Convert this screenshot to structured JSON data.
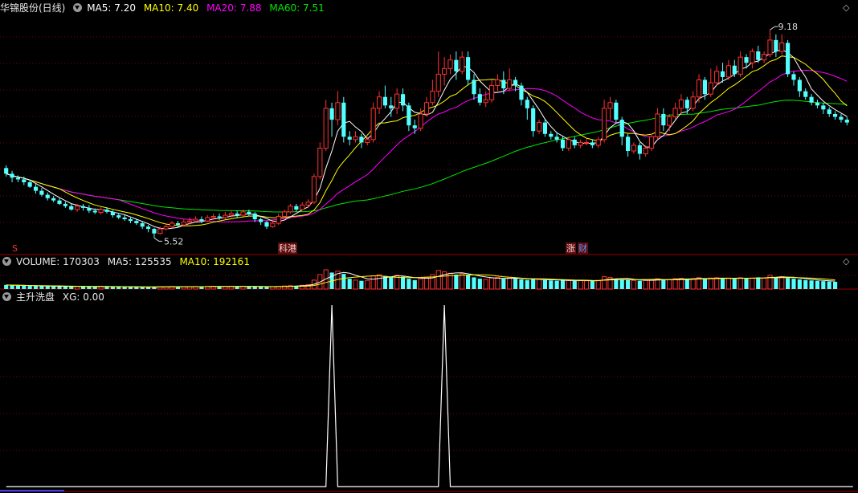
{
  "main_header": {
    "stock_name": "华锦股份(日线)",
    "ma5_label": "MA5: 7.20",
    "ma10_label": "MA10: 7.40",
    "ma20_label": "MA20: 7.88",
    "ma60_label": "MA60: 7.51"
  },
  "volume_header": {
    "volume_label": "VOLUME: 170303",
    "ma5_label": "MA5: 125535",
    "ma10_label": "MA10: 192161"
  },
  "indicator_header": {
    "name": "主升洗盘",
    "xg_label": "XG: 0.00"
  },
  "colors": {
    "up": "#ff3232",
    "down": "#54ffff",
    "ma5": "#ffffff",
    "ma10": "#ffff00",
    "ma20": "#ff00ff",
    "ma60": "#00e600",
    "grid": "#7a0000"
  },
  "chart_data": [
    {
      "type": "candlestick",
      "ylim": [
        5.3,
        9.45
      ],
      "high_marker": "9.18",
      "low_marker": "5.52",
      "event_badges": [
        "S",
        "科港",
        "涨",
        "财"
      ],
      "candles": [
        [
          6.75,
          6.65,
          6.8,
          6.6
        ],
        [
          6.65,
          6.58,
          6.7,
          6.5
        ],
        [
          6.58,
          6.55,
          6.62,
          6.5
        ],
        [
          6.55,
          6.5,
          6.6,
          6.45
        ],
        [
          6.5,
          6.42,
          6.55,
          6.4
        ],
        [
          6.42,
          6.35,
          6.47,
          6.3
        ],
        [
          6.35,
          6.28,
          6.4,
          6.25
        ],
        [
          6.28,
          6.22,
          6.32,
          6.18
        ],
        [
          6.22,
          6.18,
          6.26,
          6.15
        ],
        [
          6.18,
          6.12,
          6.22,
          6.1
        ],
        [
          6.12,
          6.08,
          6.16,
          6.05
        ],
        [
          6.08,
          6.02,
          6.12,
          6.0
        ],
        [
          6.02,
          6.08,
          6.12,
          5.98
        ],
        [
          6.08,
          6.05,
          6.12,
          6.0
        ],
        [
          6.05,
          6.0,
          6.1,
          5.96
        ],
        [
          6.0,
          5.97,
          6.04,
          5.94
        ],
        [
          5.97,
          6.02,
          6.06,
          5.93
        ],
        [
          6.02,
          5.98,
          6.06,
          5.95
        ],
        [
          5.98,
          5.92,
          6.01,
          5.88
        ],
        [
          5.92,
          5.88,
          5.96,
          5.85
        ],
        [
          5.88,
          5.85,
          5.92,
          5.82
        ],
        [
          5.85,
          5.82,
          5.88,
          5.78
        ],
        [
          5.82,
          5.78,
          5.85,
          5.75
        ],
        [
          5.78,
          5.72,
          5.82,
          5.68
        ],
        [
          5.72,
          5.68,
          5.75,
          5.62
        ],
        [
          5.68,
          5.6,
          5.7,
          5.52
        ],
        [
          5.6,
          5.68,
          5.72,
          5.58
        ],
        [
          5.68,
          5.72,
          5.78,
          5.65
        ],
        [
          5.72,
          5.78,
          5.82,
          5.7
        ],
        [
          5.78,
          5.75,
          5.82,
          5.7
        ],
        [
          5.75,
          5.8,
          5.85,
          5.72
        ],
        [
          5.8,
          5.82,
          5.88,
          5.76
        ],
        [
          5.82,
          5.85,
          5.9,
          5.8
        ],
        [
          5.85,
          5.82,
          5.9,
          5.78
        ],
        [
          5.82,
          5.88,
          5.92,
          5.8
        ],
        [
          5.88,
          5.9,
          5.95,
          5.84
        ],
        [
          5.9,
          5.88,
          5.95,
          5.84
        ],
        [
          5.88,
          5.92,
          5.98,
          5.85
        ],
        [
          5.92,
          5.95,
          6.0,
          5.88
        ],
        [
          5.95,
          5.92,
          6.0,
          5.88
        ],
        [
          5.92,
          5.98,
          6.02,
          5.9
        ],
        [
          5.98,
          5.95,
          6.02,
          5.9
        ],
        [
          5.95,
          5.85,
          5.98,
          5.8
        ],
        [
          5.85,
          5.8,
          5.88,
          5.75
        ],
        [
          5.8,
          5.72,
          5.82,
          5.68
        ],
        [
          5.72,
          5.78,
          5.82,
          5.7
        ],
        [
          5.78,
          5.9,
          5.95,
          5.75
        ],
        [
          5.9,
          5.98,
          6.02,
          5.86
        ],
        [
          5.98,
          6.08,
          6.12,
          5.95
        ],
        [
          6.08,
          6.02,
          6.12,
          5.98
        ],
        [
          6.02,
          6.1,
          6.15,
          6.0
        ],
        [
          6.1,
          6.15,
          6.2,
          6.05
        ],
        [
          6.15,
          6.6,
          6.65,
          6.12
        ],
        [
          6.6,
          7.1,
          7.2,
          6.55
        ],
        [
          7.1,
          7.8,
          7.95,
          7.05
        ],
        [
          7.8,
          7.6,
          7.9,
          7.3
        ],
        [
          7.6,
          7.9,
          8.1,
          7.5
        ],
        [
          7.9,
          7.3,
          8.0,
          7.2
        ],
        [
          7.3,
          7.25,
          7.4,
          7.15
        ],
        [
          7.25,
          7.3,
          7.4,
          7.2
        ],
        [
          7.3,
          7.2,
          7.35,
          7.1
        ],
        [
          7.2,
          7.25,
          7.3,
          7.15
        ],
        [
          7.25,
          7.8,
          7.9,
          7.2
        ],
        [
          7.8,
          8.0,
          8.1,
          7.7
        ],
        [
          8.0,
          7.85,
          8.2,
          7.8
        ],
        [
          7.85,
          7.8,
          8.0,
          7.65
        ],
        [
          7.8,
          8.05,
          8.15,
          7.7
        ],
        [
          8.05,
          7.85,
          8.15,
          7.75
        ],
        [
          7.85,
          7.5,
          7.9,
          7.4
        ],
        [
          7.5,
          7.45,
          7.6,
          7.35
        ],
        [
          7.45,
          7.7,
          7.8,
          7.4
        ],
        [
          7.7,
          7.9,
          8.0,
          7.65
        ],
        [
          7.9,
          8.1,
          8.3,
          7.85
        ],
        [
          8.1,
          8.4,
          8.8,
          8.0
        ],
        [
          8.4,
          8.5,
          8.7,
          8.2
        ],
        [
          8.5,
          8.65,
          8.75,
          8.4
        ],
        [
          8.65,
          8.45,
          8.8,
          8.3
        ],
        [
          8.45,
          8.7,
          8.8,
          8.4
        ],
        [
          8.7,
          8.3,
          8.8,
          8.2
        ],
        [
          8.3,
          8.05,
          8.4,
          7.95
        ],
        [
          8.05,
          7.9,
          8.15,
          7.85
        ],
        [
          7.9,
          7.95,
          8.1,
          7.82
        ],
        [
          7.95,
          8.2,
          8.3,
          7.9
        ],
        [
          8.2,
          8.3,
          8.4,
          8.1
        ],
        [
          8.3,
          8.15,
          8.45,
          8.05
        ],
        [
          8.15,
          8.3,
          8.5,
          8.1
        ],
        [
          8.3,
          8.2,
          8.35,
          8.1
        ],
        [
          8.2,
          7.95,
          8.25,
          7.85
        ],
        [
          7.95,
          7.8,
          8.0,
          7.6
        ],
        [
          7.8,
          7.4,
          7.85,
          7.3
        ],
        [
          7.4,
          7.55,
          7.6,
          7.35
        ],
        [
          7.55,
          7.35,
          7.6,
          7.3
        ],
        [
          7.35,
          7.3,
          7.4,
          7.25
        ],
        [
          7.3,
          7.25,
          7.38,
          7.2
        ],
        [
          7.25,
          7.1,
          7.3,
          7.05
        ],
        [
          7.1,
          7.25,
          7.3,
          7.05
        ],
        [
          7.25,
          7.15,
          7.3,
          7.1
        ],
        [
          7.15,
          7.2,
          7.25,
          7.1
        ],
        [
          7.2,
          7.2,
          7.28,
          7.15
        ],
        [
          7.2,
          7.15,
          7.25,
          7.1
        ],
        [
          7.15,
          7.25,
          7.3,
          7.1
        ],
        [
          7.25,
          7.8,
          7.95,
          7.2
        ],
        [
          7.8,
          7.9,
          8.0,
          7.6
        ],
        [
          7.9,
          7.6,
          7.95,
          7.55
        ],
        [
          7.6,
          7.3,
          7.65,
          7.15
        ],
        [
          7.3,
          7.05,
          7.35,
          6.95
        ],
        [
          7.05,
          7.15,
          7.2,
          7.0
        ],
        [
          7.15,
          7.0,
          7.2,
          6.9
        ],
        [
          7.0,
          7.1,
          7.15,
          6.95
        ],
        [
          7.1,
          7.3,
          7.35,
          7.05
        ],
        [
          7.3,
          7.7,
          7.8,
          7.25
        ],
        [
          7.7,
          7.5,
          7.8,
          7.4
        ],
        [
          7.5,
          7.65,
          7.7,
          7.4
        ],
        [
          7.65,
          7.8,
          7.9,
          7.6
        ],
        [
          7.8,
          7.95,
          8.05,
          7.7
        ],
        [
          7.95,
          7.8,
          8.0,
          7.7
        ],
        [
          7.8,
          8.0,
          8.1,
          7.75
        ],
        [
          8.0,
          8.3,
          8.4,
          7.9
        ],
        [
          8.3,
          8.05,
          8.35,
          7.95
        ],
        [
          8.05,
          8.25,
          8.5,
          8.0
        ],
        [
          8.25,
          8.45,
          8.55,
          8.2
        ],
        [
          8.45,
          8.35,
          8.6,
          8.25
        ],
        [
          8.35,
          8.55,
          8.65,
          8.3
        ],
        [
          8.55,
          8.4,
          8.65,
          8.35
        ],
        [
          8.4,
          8.7,
          8.8,
          8.35
        ],
        [
          8.7,
          8.6,
          8.75,
          8.5
        ],
        [
          8.6,
          8.8,
          8.85,
          8.5
        ],
        [
          8.8,
          8.65,
          8.9,
          8.6
        ],
        [
          8.65,
          8.75,
          8.8,
          8.6
        ],
        [
          8.75,
          9.0,
          9.18,
          8.7
        ],
        [
          9.0,
          8.8,
          9.1,
          8.7
        ],
        [
          8.8,
          8.95,
          9.1,
          8.75
        ],
        [
          8.95,
          8.4,
          9.0,
          8.35
        ],
        [
          8.4,
          8.3,
          8.45,
          8.2
        ],
        [
          8.3,
          8.1,
          8.35,
          8.0
        ],
        [
          8.1,
          8.0,
          8.15,
          7.95
        ],
        [
          8.0,
          7.9,
          8.05,
          7.85
        ],
        [
          7.9,
          7.85,
          7.95,
          7.8
        ],
        [
          7.85,
          7.78,
          7.9,
          7.7
        ],
        [
          7.78,
          7.7,
          7.82,
          7.65
        ],
        [
          7.7,
          7.65,
          7.75,
          7.6
        ],
        [
          7.65,
          7.6,
          7.7,
          7.55
        ],
        [
          7.6,
          7.55,
          7.65,
          7.5
        ]
      ]
    },
    {
      "type": "bar",
      "ylabel": "VOLUME",
      "series": [
        {
          "name": "VOLUME",
          "values": [
            120,
            110,
            100,
            95,
            90,
            90,
            85,
            80,
            80,
            75,
            75,
            70,
            80,
            75,
            70,
            70,
            75,
            70,
            65,
            65,
            60,
            60,
            60,
            55,
            60,
            70,
            65,
            70,
            75,
            65,
            70,
            70,
            75,
            70,
            75,
            80,
            70,
            75,
            80,
            75,
            80,
            75,
            70,
            65,
            60,
            70,
            80,
            90,
            100,
            95,
            110,
            130,
            260,
            420,
            560,
            480,
            520,
            440,
            300,
            260,
            240,
            250,
            380,
            420,
            380,
            340,
            400,
            360,
            300,
            260,
            300,
            340,
            420,
            540,
            500,
            460,
            420,
            440,
            400,
            340,
            300,
            280,
            320,
            340,
            300,
            320,
            300,
            280,
            260,
            300,
            280,
            260,
            250,
            240,
            260,
            250,
            240,
            245,
            240,
            235,
            250,
            360,
            340,
            300,
            280,
            260,
            250,
            240,
            250,
            270,
            300,
            280,
            280,
            300,
            310,
            290,
            300,
            330,
            300,
            320,
            330,
            310,
            320,
            300,
            330,
            310,
            320,
            340,
            320,
            400,
            340,
            360,
            320,
            300,
            280,
            260,
            250,
            240,
            230,
            220,
            210
          ]
        }
      ],
      "ma5": "MA5: 125535",
      "ma10": "MA10: 192161"
    },
    {
      "type": "line",
      "series": [
        {
          "name": "XG",
          "values": [
            0,
            0,
            0,
            0,
            0,
            0,
            0,
            0,
            0,
            0,
            0,
            0,
            0,
            0,
            0,
            0,
            0,
            0,
            0,
            0,
            0,
            0,
            0,
            0,
            0,
            0,
            0,
            0,
            0,
            0,
            0,
            0,
            0,
            0,
            0,
            0,
            0,
            0,
            0,
            0,
            0,
            0,
            0,
            0,
            0,
            0,
            0,
            0,
            0,
            0,
            0,
            0,
            0,
            0,
            0,
            1,
            0,
            0,
            0,
            0,
            0,
            0,
            0,
            0,
            0,
            0,
            0,
            0,
            0,
            0,
            0,
            0,
            0,
            0,
            1,
            0,
            0,
            0,
            0,
            0,
            0,
            0,
            0,
            0,
            0,
            0,
            0,
            0,
            0,
            0,
            0,
            0,
            0,
            0,
            0,
            0,
            0,
            0,
            0,
            0,
            0,
            0,
            0,
            0,
            0,
            0,
            0,
            0,
            0,
            0,
            0,
            0,
            0,
            0,
            0,
            0,
            0,
            0,
            0,
            0,
            0,
            0,
            0,
            0,
            0,
            0,
            0,
            0,
            0,
            0,
            0,
            0,
            0,
            0,
            0,
            0,
            0,
            0,
            0,
            0,
            0,
            0,
            0,
            0
          ]
        }
      ],
      "ylim": [
        0,
        1
      ]
    }
  ]
}
